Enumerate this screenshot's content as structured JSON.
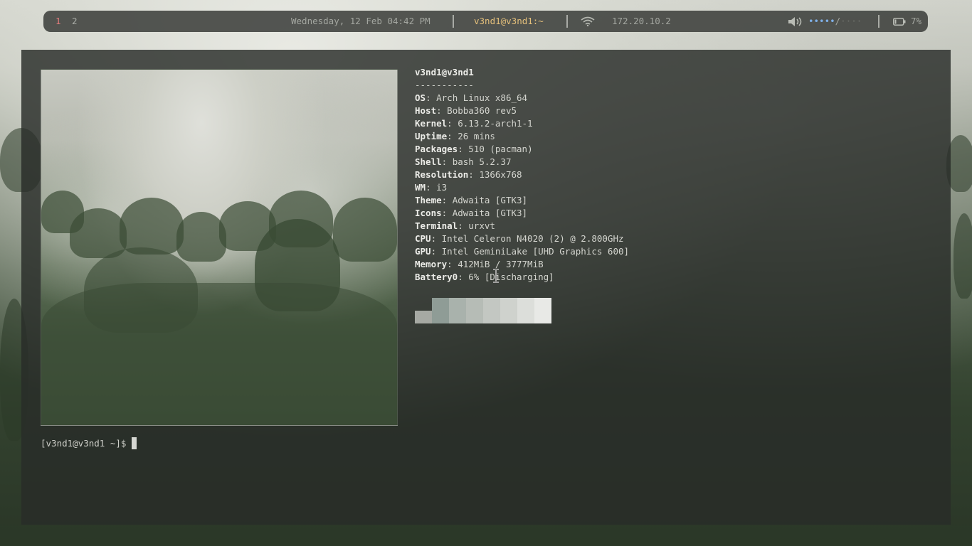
{
  "bar": {
    "workspaces": [
      "1",
      "2"
    ],
    "datetime": "Wednesday, 12 Feb 04:42 PM",
    "window_title": "v3nd1@v3nd1:~",
    "ip": "172.20.10.2",
    "volume_filled": "•••••",
    "volume_sep": "/",
    "volume_empty": "····",
    "battery": "7%",
    "colors": {
      "active_ws": "#e27c7c",
      "title": "#e5c07b",
      "volume": "#7fb0e8"
    },
    "icons": [
      "wifi-icon",
      "speaker-icon",
      "battery-icon"
    ]
  },
  "fetch": {
    "header": "v3nd1@v3nd1",
    "underline": "-----------",
    "rows": [
      {
        "key": "OS",
        "value": "Arch Linux x86_64"
      },
      {
        "key": "Host",
        "value": "Bobba360 rev5"
      },
      {
        "key": "Kernel",
        "value": "6.13.2-arch1-1"
      },
      {
        "key": "Uptime",
        "value": "26 mins"
      },
      {
        "key": "Packages",
        "value": "510 (pacman)"
      },
      {
        "key": "Shell",
        "value": "bash 5.2.37"
      },
      {
        "key": "Resolution",
        "value": "1366x768"
      },
      {
        "key": "WM",
        "value": "i3"
      },
      {
        "key": "Theme",
        "value": "Adwaita [GTK3]"
      },
      {
        "key": "Icons",
        "value": "Adwaita [GTK3]"
      },
      {
        "key": "Terminal",
        "value": "urxvt"
      },
      {
        "key": "CPU",
        "value": "Intel Celeron N4020 (2) @ 2.800GHz"
      },
      {
        "key": "GPU",
        "value": "Intel GeminiLake [UHD Graphics 600]"
      },
      {
        "key": "Memory",
        "value": "412MiB / 3777MiB"
      },
      {
        "key": "Battery0",
        "value": "6% [Discharging]"
      }
    ],
    "separator": ": ",
    "palette": [
      "#a6a9a3",
      "#8f9c96",
      "#a9b2ac",
      "#b6bcb6",
      "#c3c7c2",
      "#cfd2cd",
      "#dcdeda",
      "#e8e9e6"
    ]
  },
  "terminal": {
    "prompt": "[v3nd1@v3nd1 ~]$"
  }
}
